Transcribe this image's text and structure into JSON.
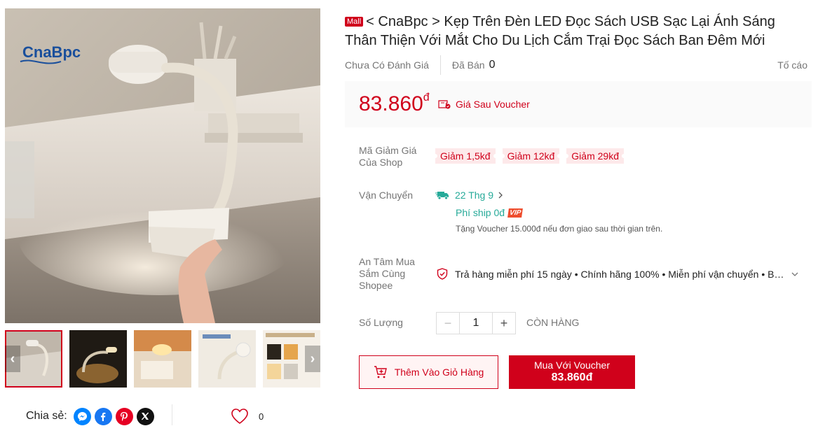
{
  "gallery": {
    "logo_text": "CnaBpc",
    "thumb_count": 5,
    "prev_arrow": "‹",
    "next_arrow": "›"
  },
  "share": {
    "label": "Chia sẻ:"
  },
  "like": {
    "count": "0"
  },
  "product": {
    "mall_badge": "Mall",
    "title": "< CnaBpc > Kẹp Trên Đèn LED Đọc Sách USB Sạc Lại Ánh Sáng Thân Thiện Với Mắt Cho Du Lịch Cắm Trại Đọc Sách Ban Đêm Mới",
    "rating_text": "Chưa Có Đánh Giá",
    "sold_label": "Đã Bán",
    "sold_value": "0",
    "report": "Tố cáo"
  },
  "price": {
    "value": "83.860",
    "currency": "đ",
    "voucher_label": "Giá Sau Voucher"
  },
  "shop_voucher": {
    "label": "Mã Giảm Giá Của Shop",
    "chips": [
      "Giảm 1,5kđ",
      "Giảm 12kđ",
      "Giảm 29kđ"
    ]
  },
  "shipping": {
    "label": "Vận Chuyển",
    "date": "22 Thg 9",
    "fee": "Phí ship 0đ",
    "vip": "VIP",
    "note": "Tặng Voucher 15.000đ nếu đơn giao sau thời gian trên."
  },
  "assurance": {
    "label": "An Tâm Mua Sắm Cùng Shopee",
    "text": "Trả hàng miễn phí 15 ngày • Chính hãng 100% • Miễn phí vận chuyển • Bảo vệ người mua"
  },
  "quantity": {
    "label": "Số Lượng",
    "value": "1",
    "minus": "−",
    "plus": "+",
    "stock": "CÒN HÀNG"
  },
  "actions": {
    "add_to_cart": "Thêm Vào Giỏ Hàng",
    "buy_line1": "Mua Với Voucher",
    "buy_price": "83.860đ"
  },
  "colors": {
    "brand_red": "#d0011b",
    "teal": "#26aa99"
  }
}
